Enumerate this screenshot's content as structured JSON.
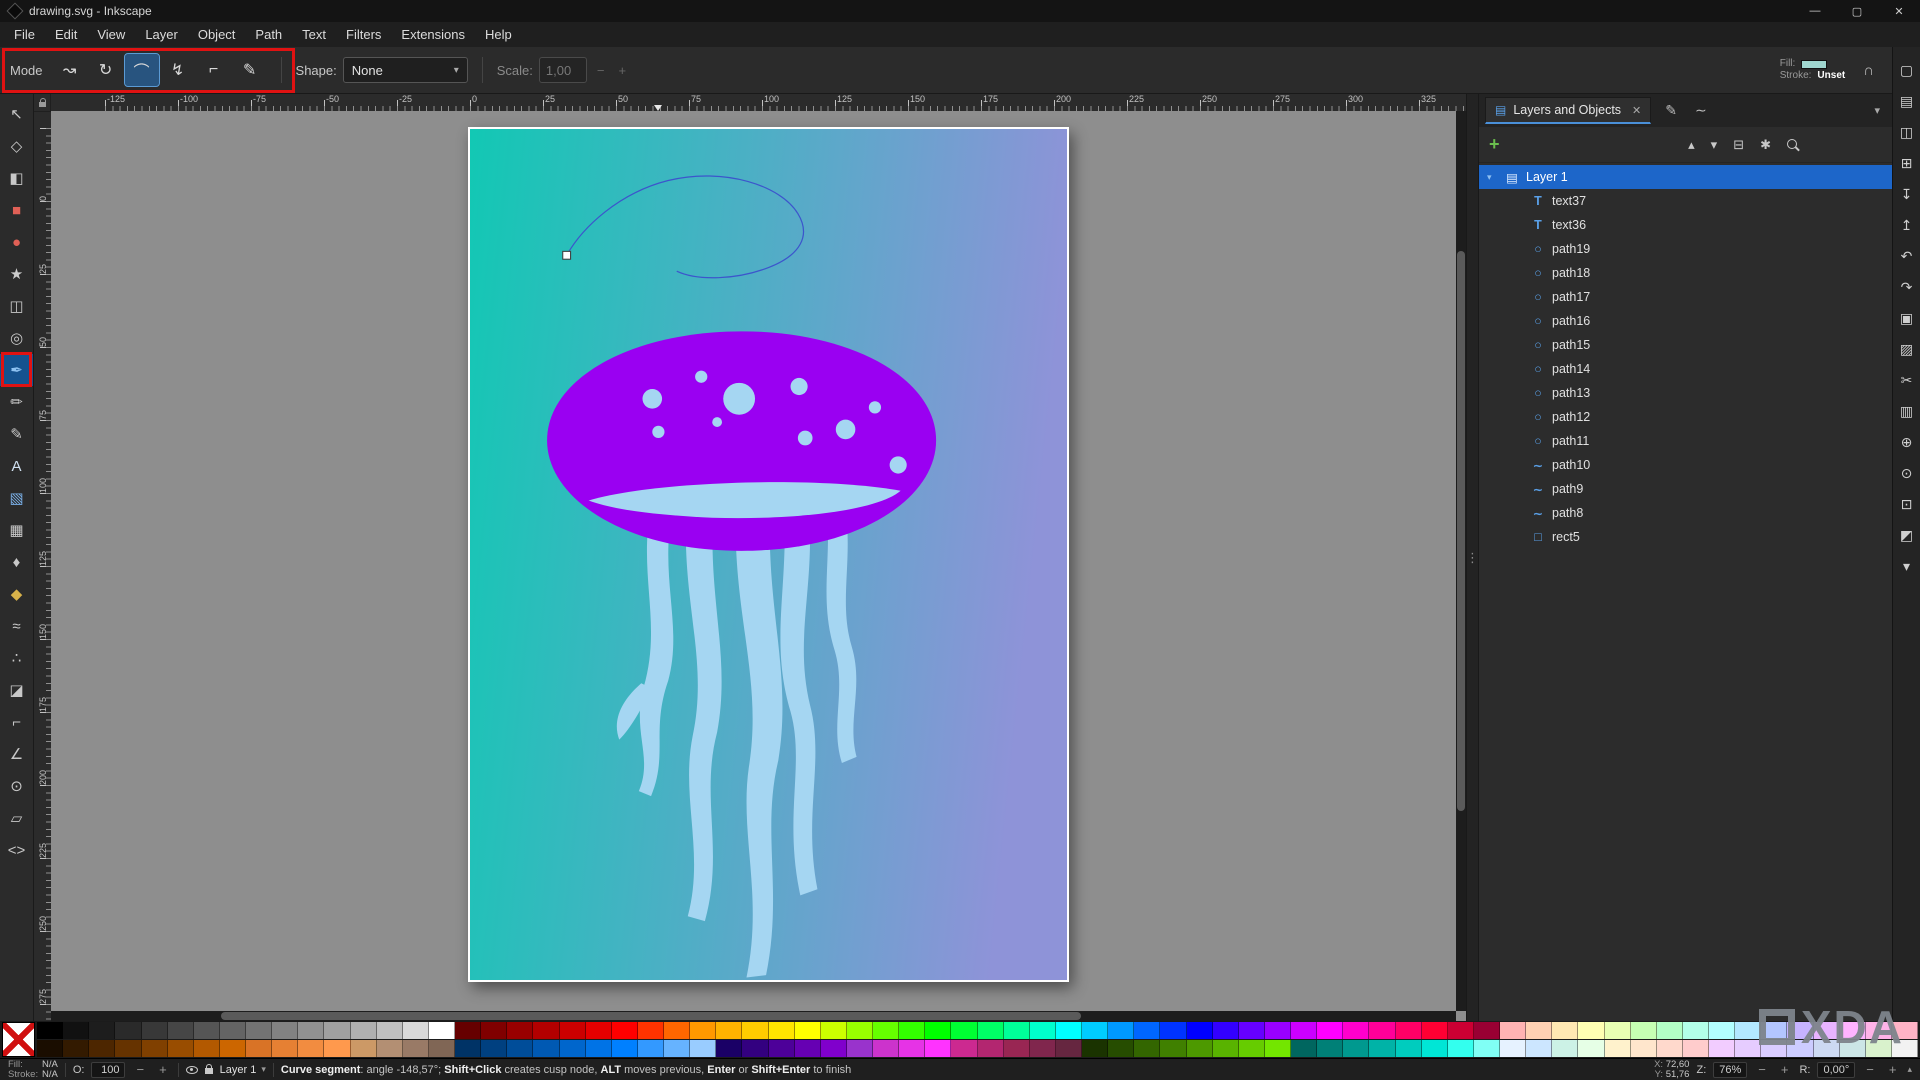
{
  "titlebar": {
    "title": "drawing.svg - Inkscape",
    "minimize_glyph": "—",
    "maximize_glyph": "▢",
    "close_glyph": "✕"
  },
  "menus": [
    {
      "label": "File"
    },
    {
      "label": "Edit"
    },
    {
      "label": "View"
    },
    {
      "label": "Layer"
    },
    {
      "label": "Object"
    },
    {
      "label": "Path"
    },
    {
      "label": "Text"
    },
    {
      "label": "Filters"
    },
    {
      "label": "Extensions"
    },
    {
      "label": "Help"
    }
  ],
  "icons": {
    "minus": "−",
    "plus": "+",
    "close": "✕",
    "chevron_down": "▾",
    "chevron_up": "▴",
    "grip": "⋮",
    "trash": "⊟",
    "gear": "✱",
    "layers": "▤",
    "brush": "✎",
    "nodes": "∼",
    "snap": "∩"
  },
  "pen_toolbar": {
    "mode_label": "Mode",
    "modes": [
      {
        "name": "mode-bezier-button",
        "glyph": "↝"
      },
      {
        "name": "mode-spiro-button",
        "glyph": "↻"
      },
      {
        "name": "mode-bspline-button",
        "glyph": "⌒",
        "active": true
      },
      {
        "name": "mode-zigzag-button",
        "glyph": "↯"
      },
      {
        "name": "mode-paraxial-button",
        "glyph": "⌐"
      },
      {
        "name": "mode-pencil-button",
        "glyph": "✎"
      }
    ],
    "shape_label": "Shape:",
    "shape_value": "None",
    "scale_label": "Scale:",
    "scale_value": "1,00"
  },
  "style_indicator": {
    "fill_label": "Fill:",
    "stroke_label": "Stroke:",
    "stroke_value": "Unset",
    "fill_color": "#9fd6cf"
  },
  "tools": [
    {
      "name": "tool-selector",
      "glyph": "↖"
    },
    {
      "name": "tool-node-editor",
      "glyph": "◇"
    },
    {
      "name": "tool-shape-builder",
      "glyph": "◧"
    },
    {
      "name": "tool-rectangle",
      "glyph": "■",
      "color": "#e06056"
    },
    {
      "name": "tool-ellipse",
      "glyph": "●",
      "color": "#e06056"
    },
    {
      "name": "tool-star",
      "glyph": "★",
      "color": "#cccccc"
    },
    {
      "name": "tool-3d-box",
      "glyph": "◫"
    },
    {
      "name": "tool-spiral",
      "glyph": "◎"
    },
    {
      "name": "tool-pen-bezier",
      "glyph": "✒",
      "color": "#8ec2f2",
      "active": true
    },
    {
      "name": "tool-pencil",
      "glyph": "✏"
    },
    {
      "name": "tool-calligraphy",
      "glyph": "✎"
    },
    {
      "name": "tool-text",
      "glyph": "A",
      "color": "#cfe0f0"
    },
    {
      "name": "tool-gradient",
      "glyph": "▧",
      "color": "#7ab0e8"
    },
    {
      "name": "tool-mesh-gradient",
      "glyph": "▦"
    },
    {
      "name": "tool-dropper",
      "glyph": "♦"
    },
    {
      "name": "tool-fill-bucket",
      "glyph": "◆",
      "color": "#d8b24a"
    },
    {
      "name": "tool-tweak",
      "glyph": "≈"
    },
    {
      "name": "tool-spray",
      "glyph": "∴"
    },
    {
      "name": "tool-eraser",
      "glyph": "◪"
    },
    {
      "name": "tool-connector",
      "glyph": "⌐"
    },
    {
      "name": "tool-measure",
      "glyph": "∠"
    },
    {
      "name": "tool-zoom",
      "glyph": "⊙"
    },
    {
      "name": "tool-pages",
      "glyph": "▱"
    },
    {
      "name": "tool-xml-editor",
      "glyph": "<>"
    }
  ],
  "commands": [
    {
      "name": "new-document-icon",
      "glyph": "▢"
    },
    {
      "name": "open-document-icon",
      "glyph": "▤"
    },
    {
      "name": "save-document-icon",
      "glyph": "◫"
    },
    {
      "name": "print-icon",
      "glyph": "⊞"
    },
    {
      "name": "import-icon",
      "glyph": "↧"
    },
    {
      "name": "export-icon",
      "glyph": "↥"
    },
    {
      "name": "undo-icon",
      "glyph": "↶"
    },
    {
      "name": "redo-icon",
      "glyph": "↷"
    },
    {
      "name": "copy-icon",
      "glyph": "▣"
    },
    {
      "name": "paste-icon",
      "glyph": "▨"
    },
    {
      "name": "cut-icon",
      "glyph": "✂"
    },
    {
      "name": "duplicate-icon",
      "glyph": "▥"
    },
    {
      "name": "zoom-selection-icon",
      "glyph": "⊕"
    },
    {
      "name": "zoom-drawing-icon",
      "glyph": "⊙"
    },
    {
      "name": "zoom-page-icon",
      "glyph": "⊡"
    },
    {
      "name": "display-mode-icon",
      "glyph": "◩"
    },
    {
      "name": "more-commands-icon",
      "glyph": "▾"
    }
  ],
  "rulers": {
    "horizontal": [
      "-125",
      "-100",
      "-75",
      "-50",
      "-25",
      "0",
      "25",
      "50",
      "75",
      "100",
      "125",
      "150",
      "175",
      "200",
      "225",
      "250",
      "275",
      "300",
      "325"
    ],
    "vertical": [
      "0",
      "25",
      "50",
      "75",
      "100",
      "125",
      "150",
      "175",
      "200",
      "225",
      "250",
      "275"
    ]
  },
  "dock": {
    "tab_title": "Layers and Objects",
    "layers": [
      {
        "name": "layer-row-layer1",
        "label": "Layer 1",
        "glyph": "▤",
        "arrow": "▾",
        "selected": true
      },
      {
        "name": "layer-row-text37",
        "label": "text37",
        "glyph": "T",
        "child": true
      },
      {
        "name": "layer-row-text36",
        "label": "text36",
        "glyph": "T",
        "child": true
      },
      {
        "name": "layer-row-path19",
        "label": "path19",
        "glyph": "○",
        "child": true
      },
      {
        "name": "layer-row-path18",
        "label": "path18",
        "glyph": "○",
        "child": true
      },
      {
        "name": "layer-row-path17",
        "label": "path17",
        "glyph": "○",
        "child": true
      },
      {
        "name": "layer-row-path16",
        "label": "path16",
        "glyph": "○",
        "child": true
      },
      {
        "name": "layer-row-path15",
        "label": "path15",
        "glyph": "○",
        "child": true
      },
      {
        "name": "layer-row-path14",
        "label": "path14",
        "glyph": "○",
        "child": true
      },
      {
        "name": "layer-row-path13",
        "label": "path13",
        "glyph": "○",
        "child": true
      },
      {
        "name": "layer-row-path12",
        "label": "path12",
        "glyph": "○",
        "child": true
      },
      {
        "name": "layer-row-path11",
        "label": "path11",
        "glyph": "○",
        "child": true
      },
      {
        "name": "layer-row-path10",
        "label": "path10",
        "glyph": "∼",
        "child": true
      },
      {
        "name": "layer-row-path9",
        "label": "path9",
        "glyph": "∼",
        "child": true
      },
      {
        "name": "layer-row-path8",
        "label": "path8",
        "glyph": "∼",
        "child": true
      },
      {
        "name": "layer-row-rect5",
        "label": "rect5",
        "glyph": "□",
        "child": true
      }
    ]
  },
  "palette": {
    "row1": [
      "#000000",
      "#111111",
      "#1d1d1d",
      "#2a2a2a",
      "#383838",
      "#464646",
      "#555555",
      "#646464",
      "#737373",
      "#828282",
      "#919191",
      "#a0a0a0",
      "#b0b0b0",
      "#c0c0c0",
      "#d9d9d9",
      "#ffffff",
      "#660000",
      "#800000",
      "#990000",
      "#b30000",
      "#cc0000",
      "#e60000",
      "#ff0000",
      "#ff3300",
      "#ff6600",
      "#ff9900",
      "#ffb300",
      "#ffcc00",
      "#ffe600",
      "#ffff00",
      "#ccff00",
      "#99ff00",
      "#66ff00",
      "#33ff00",
      "#00ff00",
      "#00ff33",
      "#00ff66",
      "#00ff99",
      "#00ffcc",
      "#00ffff",
      "#00ccff",
      "#0099ff",
      "#0066ff",
      "#0033ff",
      "#0000ff",
      "#3300ff",
      "#6600ff",
      "#9900ff",
      "#cc00ff",
      "#ff00ff",
      "#ff00cc",
      "#ff0099",
      "#ff0066",
      "#ff0033",
      "#cc0033",
      "#990033",
      "#ffb3b3",
      "#ffd1b3",
      "#ffe8b3",
      "#ffffb3",
      "#e8ffb3",
      "#c6ffb3",
      "#b3ffc6",
      "#b3ffe8",
      "#b3ffff",
      "#b3e8ff",
      "#b3c6ff",
      "#c6b3ff",
      "#e8b3ff",
      "#ffb3ff",
      "#ffb3e8",
      "#ffb3c6"
    ],
    "row2": [
      "#1a0d00",
      "#331a00",
      "#4d2600",
      "#663300",
      "#804000",
      "#994d00",
      "#b35900",
      "#cc6600",
      "#d97326",
      "#e68033",
      "#f28c40",
      "#ff994d",
      "#cc9966",
      "#b38f73",
      "#997a66",
      "#806655",
      "#003366",
      "#004080",
      "#004d99",
      "#0059b3",
      "#0066cc",
      "#0073e6",
      "#0080ff",
      "#3399ff",
      "#66b3ff",
      "#99ccff",
      "#1a0066",
      "#330080",
      "#4d0099",
      "#6600b3",
      "#8000cc",
      "#9933cc",
      "#cc33cc",
      "#e633e6",
      "#ff33ff",
      "#cc2990",
      "#b32670",
      "#992653",
      "#80264d",
      "#662640",
      "#1a3300",
      "#264d00",
      "#336600",
      "#408000",
      "#4d9900",
      "#59b300",
      "#66cc00",
      "#73e600",
      "#00665f",
      "#008077",
      "#00998f",
      "#00b3a7",
      "#00ccbe",
      "#00e6d6",
      "#33ffee",
      "#80fff5",
      "#e6f2ff",
      "#cce6ff",
      "#ccf2e6",
      "#e6ffe6",
      "#fff2cc",
      "#ffe6cc",
      "#ffd9cc",
      "#ffcccc",
      "#f2ccff",
      "#e6ccff",
      "#d9ccff",
      "#ccccff",
      "#ccd9f2",
      "#cce6e6",
      "#d9f2cc",
      "#f2f2f2"
    ]
  },
  "statusbar": {
    "fill_label": "Fill:",
    "fill_value": "N/A",
    "stroke_label": "Stroke:",
    "stroke_value": "N/A",
    "opacity_label": "O:",
    "opacity_value": "100",
    "layer_name": "Layer 1",
    "message_parts": [
      {
        "t": "Curve segment",
        "bold": true
      },
      {
        "t": ": angle -148,57°; "
      },
      {
        "t": "Shift+Click",
        "bold": true
      },
      {
        "t": " creates cusp node, "
      },
      {
        "t": "ALT",
        "bold": true
      },
      {
        "t": " moves previous, "
      },
      {
        "t": "Enter",
        "bold": true
      },
      {
        "t": " or "
      },
      {
        "t": "Shift+Enter",
        "bold": true
      },
      {
        "t": " to finish"
      }
    ],
    "x_label": "X:",
    "x_value": "72,60",
    "y_label": "Y:",
    "y_value": "51,76",
    "zoom_label": "Z:",
    "zoom_value": "76%",
    "rotation_label": "R:",
    "rotation_value": "0,00°"
  },
  "watermark": "XDA",
  "colors": {
    "annotation_red": "#e01212",
    "accent_blue": "#1d66c9",
    "page_gradient_start": "#12c8b4",
    "page_gradient_end": "#8e93d8",
    "cap_purple": "#9a00f2",
    "jelly_blue": "#a5d6f2",
    "curve_blue": "#3c55cc",
    "fill_swatch": "#9fd6cf"
  }
}
